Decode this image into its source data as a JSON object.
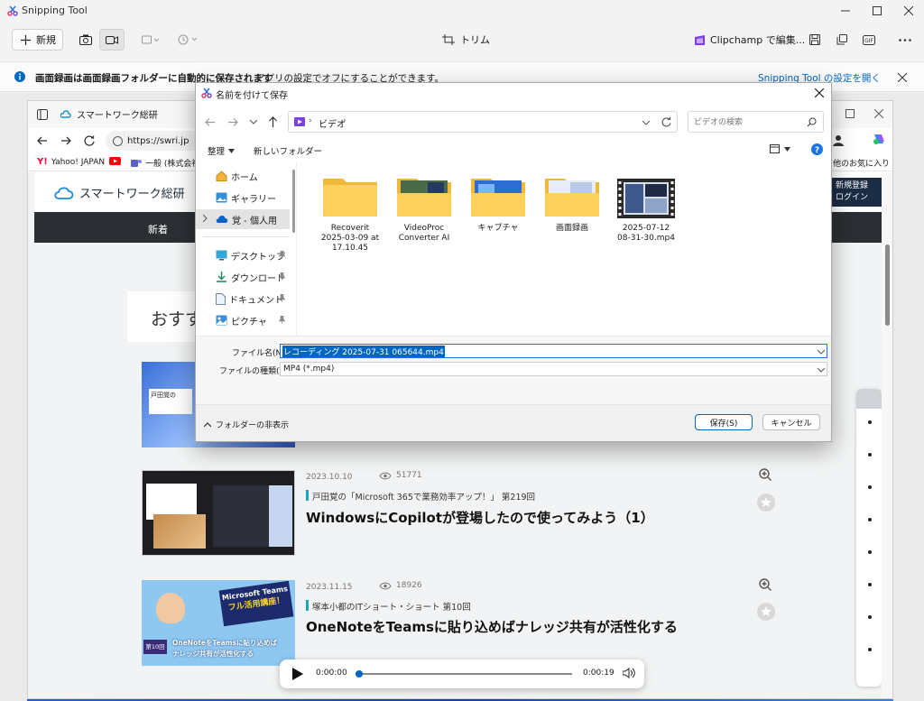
{
  "app": {
    "title": "Snipping Tool"
  },
  "toolbar": {
    "new_label": "新規",
    "trim_label": "トリム",
    "clipchamp_label": "Clipchamp で編集..."
  },
  "info_bar": {
    "bold_text": "画面録画は画面録画フォルダーに自動的に保存されます",
    "text": "アプリの設定でオフにすることができます。",
    "link": "Snipping Tool の設定を開く"
  },
  "browser": {
    "tab_title": "スマートワーク総研",
    "url": "https://swri.jp",
    "bookmarks": [
      "Yahoo! JAPAN",
      "一般 (株式会社"
    ],
    "bookmarks_right": "他のお気に入り",
    "site_name": "スマートワーク総研",
    "register_line1": "新規登録",
    "register_line2": "ログイン",
    "nav_item": "新着",
    "section_prefix": "おすす",
    "articles": [
      {
        "date": "2023.10.10",
        "views": "51771",
        "series": "戸田覚の「Microsoft 365で業務効率アップ！」 第219回",
        "title": "WindowsにCopilotが登場したので使ってみよう（1）"
      },
      {
        "date": "2023.11.15",
        "views": "18926",
        "series": "塚本小都のITショート・ショート 第10回",
        "title": "OneNoteをTeamsに貼り込めばナレッジ共有が活性化する"
      }
    ],
    "thumb1_text": "戸田覚の",
    "thumb3_heading": "Microsoft Teams",
    "thumb3_sub": "フル活用講座！",
    "thumb3_badge": "第10回",
    "thumb3_caption1": "OneNoteをTeamsに貼り込めば",
    "thumb3_caption2": "ナレッジ共有が活性化する"
  },
  "player": {
    "current": "0:00:00",
    "duration": "0:00:19",
    "progress": 0.0
  },
  "dialog": {
    "title": "名前を付けて保存",
    "breadcrumb": "ビデオ",
    "search_placeholder": "ビデオの検索",
    "organize_label": "整理",
    "new_folder_label": "新しいフォルダー",
    "nav": [
      {
        "label": "ホーム",
        "icon": "home-icon"
      },
      {
        "label": "ギャラリー",
        "icon": "gallery-icon"
      },
      {
        "label": "覚 - 個人用",
        "icon": "onedrive-icon"
      },
      {
        "label": "デスクトップ",
        "icon": "desktop-icon"
      },
      {
        "label": "ダウンロード",
        "icon": "download-icon"
      },
      {
        "label": "ドキュメント",
        "icon": "document-icon"
      },
      {
        "label": "ピクチャ",
        "icon": "pictures-icon"
      }
    ],
    "files": [
      {
        "line1": "Recoverit",
        "line2": "2025-03-09 at",
        "line3": "17.10.45"
      },
      {
        "line1": "VideoProc",
        "line2": "Converter AI",
        "line3": ""
      },
      {
        "line1": "キャプチャ",
        "line2": "",
        "line3": ""
      },
      {
        "line1": "画面録画",
        "line2": "",
        "line3": ""
      },
      {
        "line1": "2025-07-12",
        "line2": "08-31-30.mp4",
        "line3": ""
      }
    ],
    "filename_label": "ファイル名(N):",
    "filename_value": "レコーディング 2025-07-31 065644.mp4",
    "filetype_label": "ファイルの種類(T):",
    "filetype_value": "MP4 (*.mp4)",
    "hide_folders_label": "フォルダーの非表示",
    "save_label": "保存(S)",
    "cancel_label": "キャンセル"
  },
  "colors": {
    "accent": "#0067c0",
    "nav_dark": "#2b2f33",
    "series_bar": "#1aa3c9"
  }
}
